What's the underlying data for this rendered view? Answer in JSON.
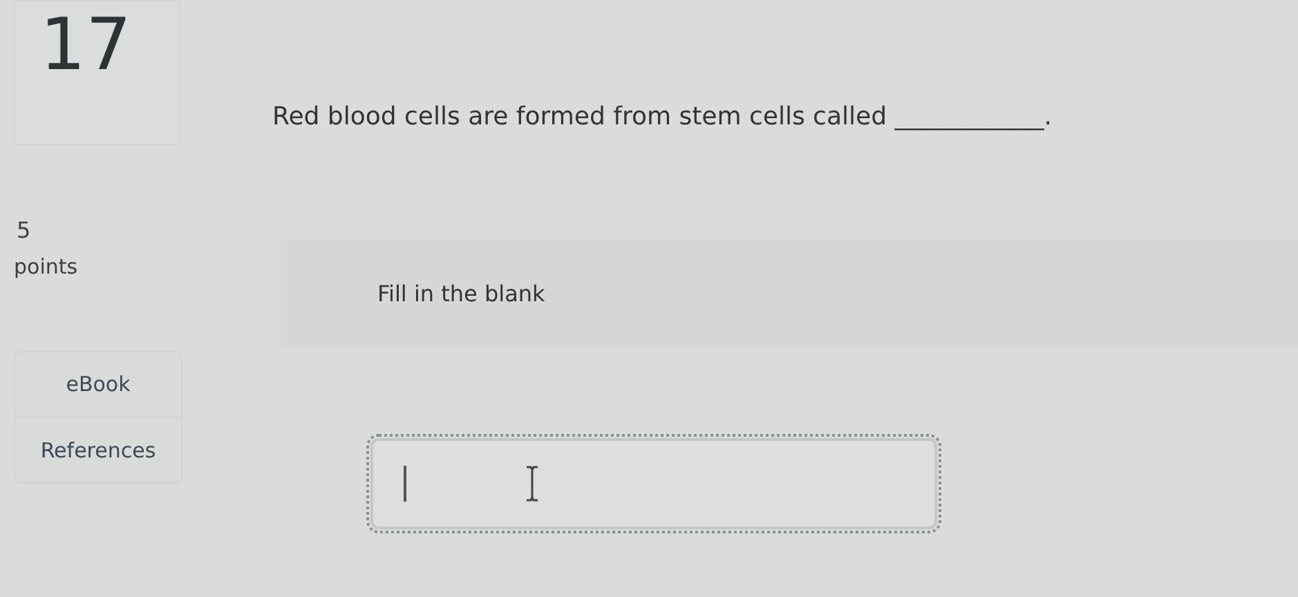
{
  "question": {
    "number": "17",
    "points_value": "5",
    "points_label": "points",
    "text": "Red blood cells are formed from stem cells called ____________."
  },
  "tools": [
    {
      "label": "eBook"
    },
    {
      "label": "References"
    }
  ],
  "instruction": "Fill in the blank",
  "answer": {
    "focused": true
  }
}
